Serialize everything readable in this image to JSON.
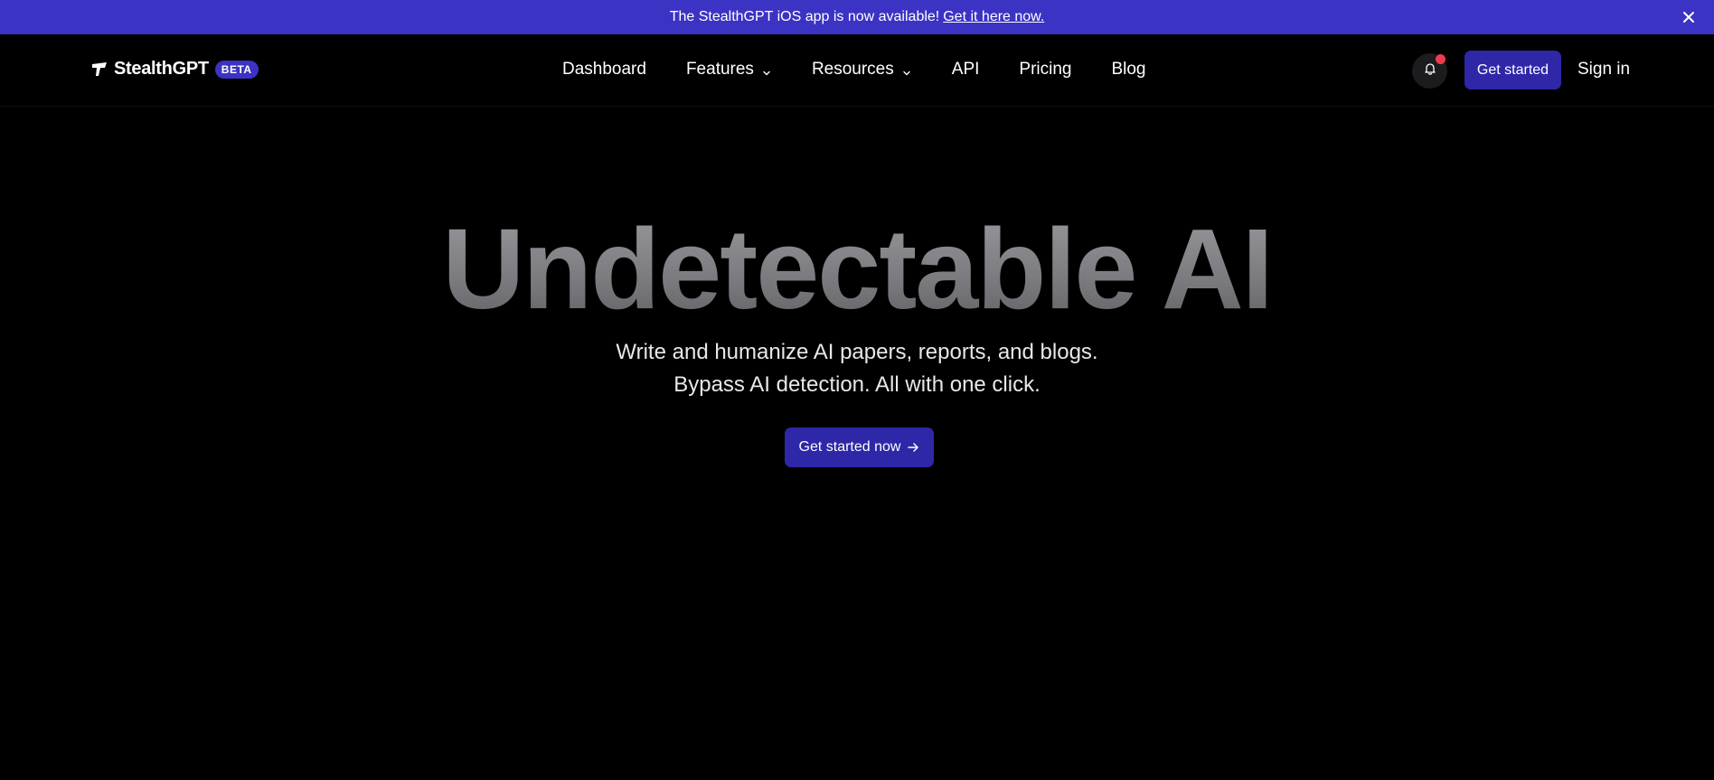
{
  "banner": {
    "message": "The StealthGPT iOS app is now available!",
    "link_text": "Get it here now.",
    "close_icon": "close-icon"
  },
  "header": {
    "logo_text": "StealthGPT",
    "badge": "BETA",
    "nav": [
      {
        "label": "Dashboard",
        "has_dropdown": false
      },
      {
        "label": "Features",
        "has_dropdown": true
      },
      {
        "label": "Resources",
        "has_dropdown": true
      },
      {
        "label": "API",
        "has_dropdown": false
      },
      {
        "label": "Pricing",
        "has_dropdown": false
      },
      {
        "label": "Blog",
        "has_dropdown": false
      }
    ],
    "notification_icon": "bell-icon",
    "get_started_label": "Get started",
    "sign_in_label": "Sign in"
  },
  "hero": {
    "title": "Undetectable AI",
    "subtitle": "Write and humanize AI papers, reports, and blogs. Bypass AI detection. All with one click.",
    "cta_label": "Get started now"
  },
  "colors": {
    "accent": "#3b33c4",
    "button": "#2e27a8",
    "background": "#000000",
    "notification_dot": "#ef3b4c"
  }
}
